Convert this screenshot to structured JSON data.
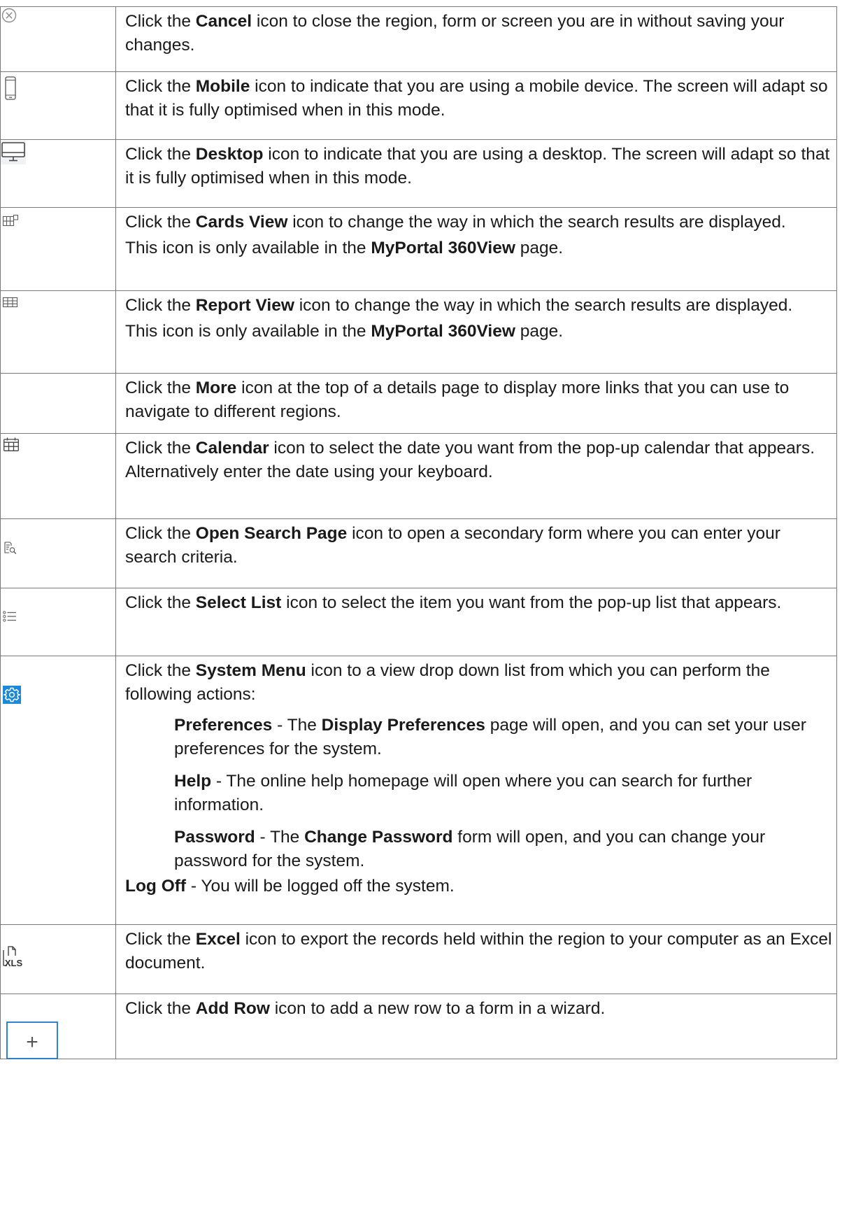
{
  "rows": [
    {
      "icon": "cancel-icon",
      "paragraphs": [
        {
          "pre": "Click the ",
          "bold": "Cancel",
          "post": " icon to close the region, form or screen you are in without saving your changes."
        }
      ]
    },
    {
      "icon": "mobile-icon",
      "paragraphs": [
        {
          "pre": "Click the ",
          "bold": "Mobile",
          "post": " icon to indicate that you are using a mobile device. The screen will adapt so that it is fully optimised when in this mode."
        }
      ]
    },
    {
      "icon": "desktop-icon",
      "paragraphs": [
        {
          "pre": "Click the ",
          "bold": "Desktop",
          "post": " icon to indicate that you are using a desktop. The screen will adapt so that it is fully optimised when in this mode."
        }
      ]
    },
    {
      "icon": "cards-view-icon",
      "paragraphs": [
        {
          "pre": "Click the ",
          "bold": "Cards View",
          "post": " icon to change the way in which the search results are displayed."
        },
        {
          "pre": "This icon is only available in the ",
          "bold": "MyPortal 360View",
          "post": " page."
        }
      ]
    },
    {
      "icon": "report-view-icon",
      "paragraphs": [
        {
          "pre": "Click the ",
          "bold": "Report View",
          "post": " icon to change the way in which the search results are displayed."
        },
        {
          "pre": "This icon is only available in the ",
          "bold": "MyPortal 360View",
          "post": " page."
        }
      ]
    },
    {
      "icon": "",
      "paragraphs": [
        {
          "pre": "Click the ",
          "bold": "More",
          "post": " icon at the top of a details page to display more links that you can use to navigate to different regions."
        }
      ]
    },
    {
      "icon": "calendar-icon",
      "paragraphs": [
        {
          "pre": "Click the ",
          "bold": "Calendar",
          "post": " icon to select the date you want from the pop-up calendar that appears. Alternatively enter the date using your keyboard."
        }
      ]
    },
    {
      "icon": "open-search-page-icon",
      "paragraphs": [
        {
          "pre": "Click the ",
          "bold": "Open Search Page",
          "post": " icon to open a secondary form where you can enter your search criteria."
        }
      ]
    },
    {
      "icon": "select-list-icon",
      "paragraphs": [
        {
          "pre": "Click the ",
          "bold": "Select List",
          "post": " icon to select the item you want from the pop-up list that appears."
        }
      ]
    },
    {
      "icon": "system-menu-icon",
      "intro": {
        "pre": "Click the ",
        "bold": "System Menu",
        "post": " icon to a view drop down list from which you can perform the following actions:"
      },
      "actions": [
        {
          "bold": "Preferences",
          "mid": " - The ",
          "bold2": "Display Preferences",
          "post": " page will open, and you can set your user preferences for the system."
        },
        {
          "bold": "Help",
          "mid": " - The online help homepage will open where you can search for further information.",
          "bold2": "",
          "post": ""
        },
        {
          "bold": "Password",
          "mid": " - The ",
          "bold2": "Change Password",
          "post": " form will open, and you can change your password for the system."
        }
      ],
      "logoff": {
        "bold": "Log Off",
        "post": " - You will be logged off the system."
      }
    },
    {
      "icon": "excel-icon",
      "icon_text": "XLS",
      "paragraphs": [
        {
          "pre": "Click the ",
          "bold": "Excel",
          "post": " icon to export the records held within the region to your computer as an Excel document."
        }
      ]
    },
    {
      "icon": "add-row-icon",
      "icon_text": "+",
      "paragraphs": [
        {
          "pre": "Click the ",
          "bold": "Add Row",
          "post": " icon to add a new row to a form in a wizard."
        }
      ]
    }
  ]
}
